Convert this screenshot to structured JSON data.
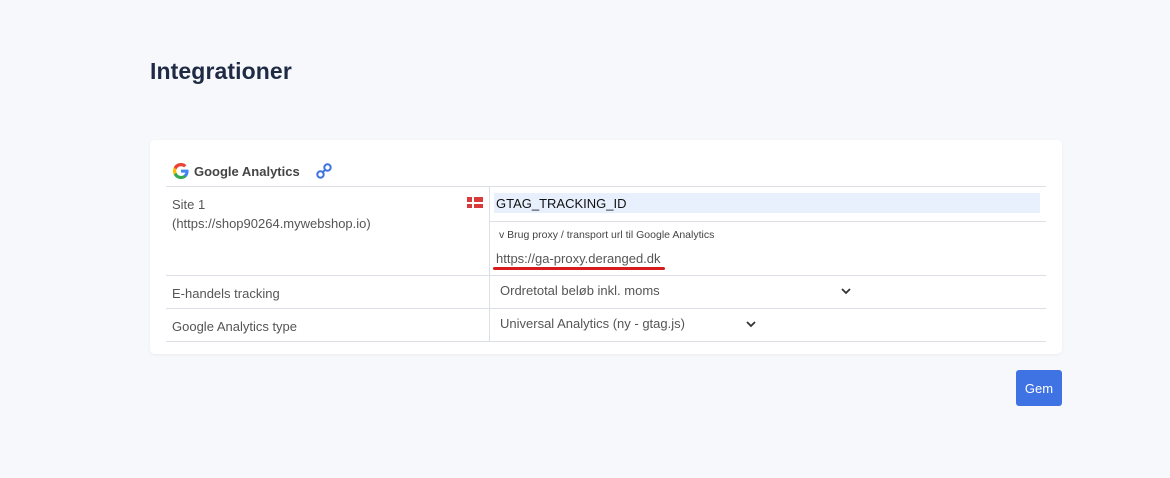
{
  "page": {
    "title": "Integrationer"
  },
  "integration": {
    "name": "Google Analytics",
    "icon": "google-logo",
    "link_icon": "link-icon"
  },
  "rows": {
    "site": {
      "label_line1": "Site 1",
      "label_line2": "(https://shop90264.mywebshop.io)",
      "flag": "denmark-flag",
      "tracking_id_value": "GTAG_TRACKING_ID",
      "proxy_toggle_label": "v Brug proxy / transport url til Google Analytics",
      "proxy_url_value": "https://ga-proxy.deranged.dk"
    },
    "ecommerce": {
      "label": "E-handels tracking",
      "selected": "Ordretotal beløb inkl. moms"
    },
    "ga_type": {
      "label": "Google Analytics type",
      "selected": "Universal Analytics (ny - gtag.js)"
    }
  },
  "actions": {
    "save_label": "Gem"
  },
  "colors": {
    "primary_button": "#3f73e4",
    "highlight_underline": "#d61c1c",
    "input_autofill_bg": "#e8f0fe",
    "page_bg": "#f7f8fb"
  }
}
